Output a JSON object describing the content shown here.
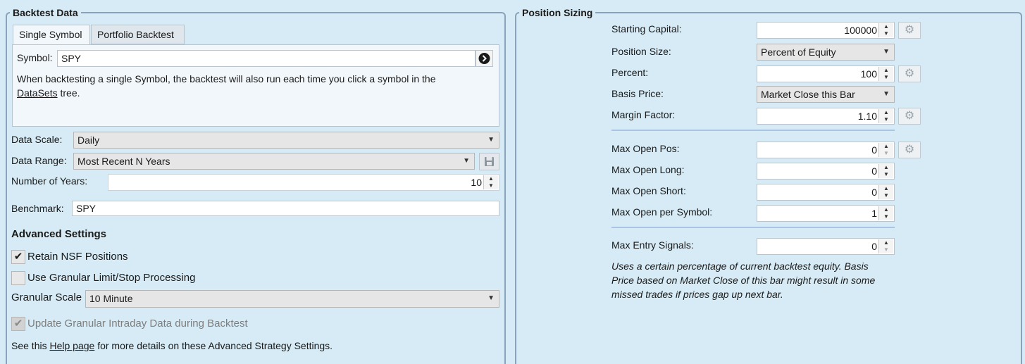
{
  "backtest": {
    "title": "Backtest Data",
    "tabs": [
      "Single Symbol",
      "Portfolio Backtest"
    ],
    "symbol_label": "Symbol:",
    "symbol_value": "SPY",
    "info_text": "When backtesting a single Symbol, the backtest will also run each time you click a symbol in the",
    "info_link": "DataSets",
    "info_tail": " tree.",
    "data_scale_label": "Data Scale:",
    "data_scale_value": "Daily",
    "data_range_label": "Data Range:",
    "data_range_value": "Most Recent N Years",
    "years_label": "Number of Years:",
    "years_value": "10",
    "benchmark_label": "Benchmark:",
    "benchmark_value": "SPY",
    "advanced_title": "Advanced Settings",
    "retain_nsf_label": "Retain NSF Positions",
    "retain_nsf_checked": true,
    "granular_label": "Use Granular Limit/Stop Processing",
    "granular_checked": false,
    "granular_scale_label": "Granular Scale",
    "granular_scale_value": "10 Minute",
    "update_intraday_label": "Update Granular Intraday Data during Backtest",
    "update_intraday_checked": true,
    "help_prefix": "See this ",
    "help_link": "Help page",
    "help_suffix": " for more details on these Advanced Strategy Settings."
  },
  "sizing": {
    "title": "Position Sizing",
    "starting_capital_label": "Starting Capital:",
    "starting_capital_value": "100000",
    "position_size_label": "Position Size:",
    "position_size_value": "Percent of Equity",
    "percent_label": "Percent:",
    "percent_value": "100",
    "basis_price_label": "Basis Price:",
    "basis_price_value": "Market Close this Bar",
    "margin_factor_label": "Margin Factor:",
    "margin_factor_value": "1.10",
    "max_open_pos_label": "Max Open Pos:",
    "max_open_pos_value": "0",
    "max_open_long_label": "Max Open Long:",
    "max_open_long_value": "0",
    "max_open_short_label": "Max Open Short:",
    "max_open_short_value": "0",
    "max_open_symbol_label": "Max Open per Symbol:",
    "max_open_symbol_value": "1",
    "max_entry_label": "Max Entry Signals:",
    "max_entry_value": "0",
    "description_1": "Uses a certain percentage of current backtest equity. Basis",
    "description_2": "Price based on Market Close of this bar might result in some",
    "description_3": "missed trades if prices gap up next bar."
  },
  "icons": {
    "go": "arrow-right-circle-icon",
    "save": "floppy-disk-icon",
    "gear": "gear-icon",
    "check": "checkmark-icon"
  }
}
